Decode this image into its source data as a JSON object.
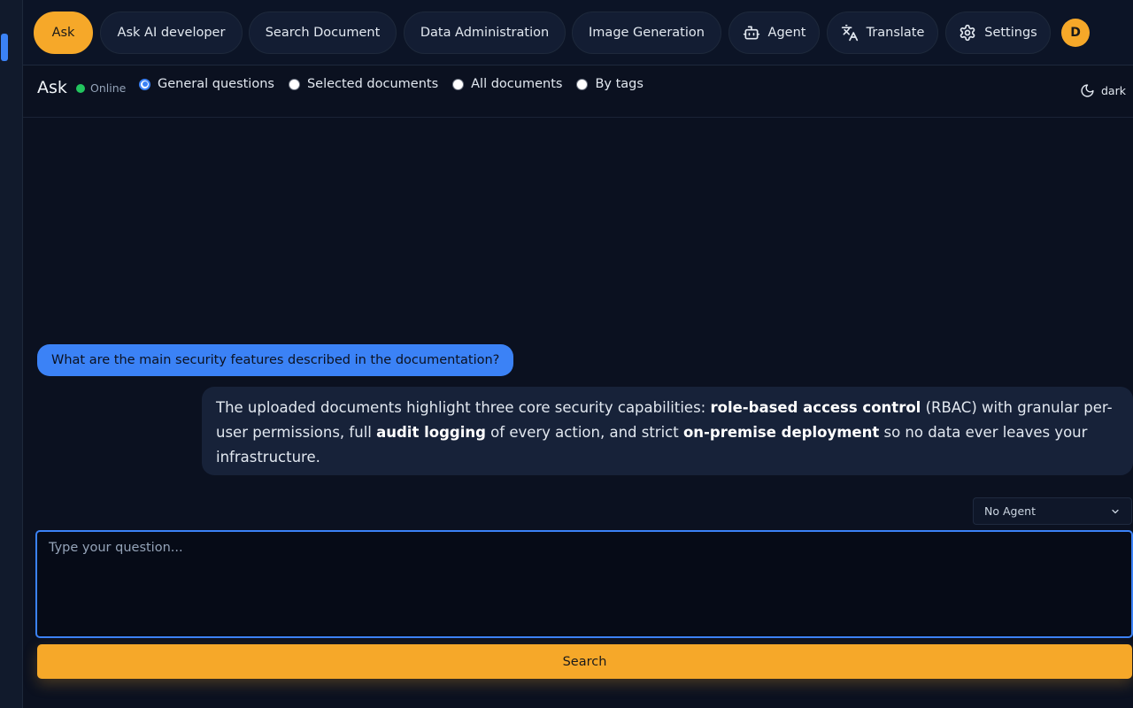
{
  "nav": {
    "items": [
      {
        "label": "Ask",
        "active": true
      },
      {
        "label": "Ask AI developer"
      },
      {
        "label": "Search Document"
      },
      {
        "label": "Data Administration"
      },
      {
        "label": "Image Generation"
      },
      {
        "label": "Agent",
        "icon": "robot-icon"
      },
      {
        "label": "Translate",
        "icon": "translate-icon"
      },
      {
        "label": "Settings",
        "icon": "gear-icon"
      }
    ],
    "avatar_initial": "D"
  },
  "header": {
    "title": "Ask",
    "status": "Online",
    "modes": [
      {
        "label": "General questions",
        "checked": true
      },
      {
        "label": "Selected documents",
        "checked": false
      },
      {
        "label": "All documents",
        "checked": false
      },
      {
        "label": "By tags",
        "checked": false
      }
    ],
    "theme_label": "dark",
    "theme_icon": "moon-icon"
  },
  "chat": {
    "user_message": "What are the main security features described in the documentation?",
    "ai_message": {
      "p1": "The uploaded documents highlight three core security capabilities: ",
      "b1": "role-based access control",
      "p2": " (RBAC) with granular per-user permissions, full ",
      "b2": "audit logging",
      "p3": " of every action, and strict ",
      "b3": "on-premise deployment",
      "p4": " so no data ever leaves your infrastructure."
    }
  },
  "agent_select": {
    "selected": "No Agent"
  },
  "input": {
    "placeholder": "Type your question..."
  },
  "search_button": {
    "label": "Search"
  },
  "colors": {
    "accent": "#f6a829",
    "primary": "#3b82f6",
    "background": "#0b1120",
    "online": "#22c55e"
  }
}
